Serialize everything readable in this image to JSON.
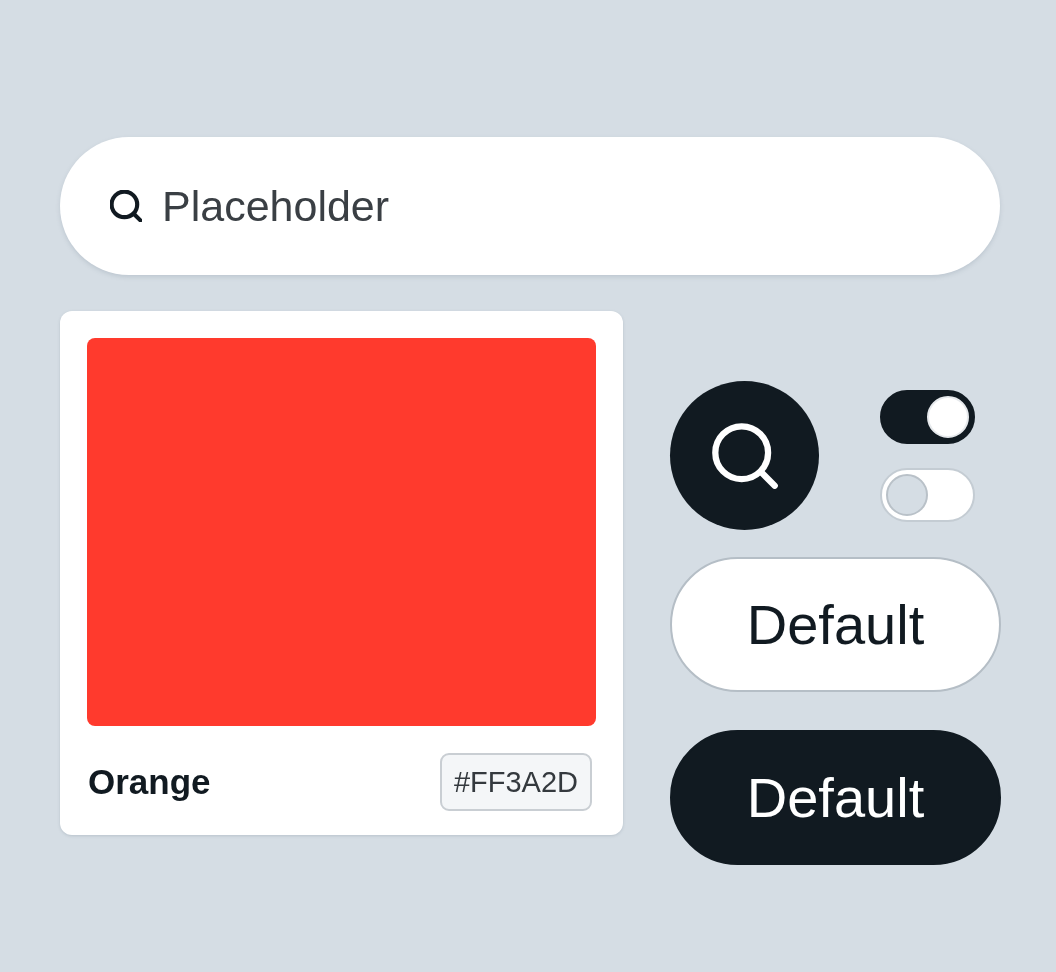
{
  "search": {
    "placeholder": "Placeholder"
  },
  "color_card": {
    "color": "#ff3a2d",
    "name": "Orange",
    "hex": "#FF3A2D"
  },
  "toggles": [
    {
      "on": true
    },
    {
      "on": false
    }
  ],
  "buttons": [
    {
      "label": "Default",
      "kind": "outline"
    },
    {
      "label": "Default",
      "kind": "filled"
    }
  ]
}
